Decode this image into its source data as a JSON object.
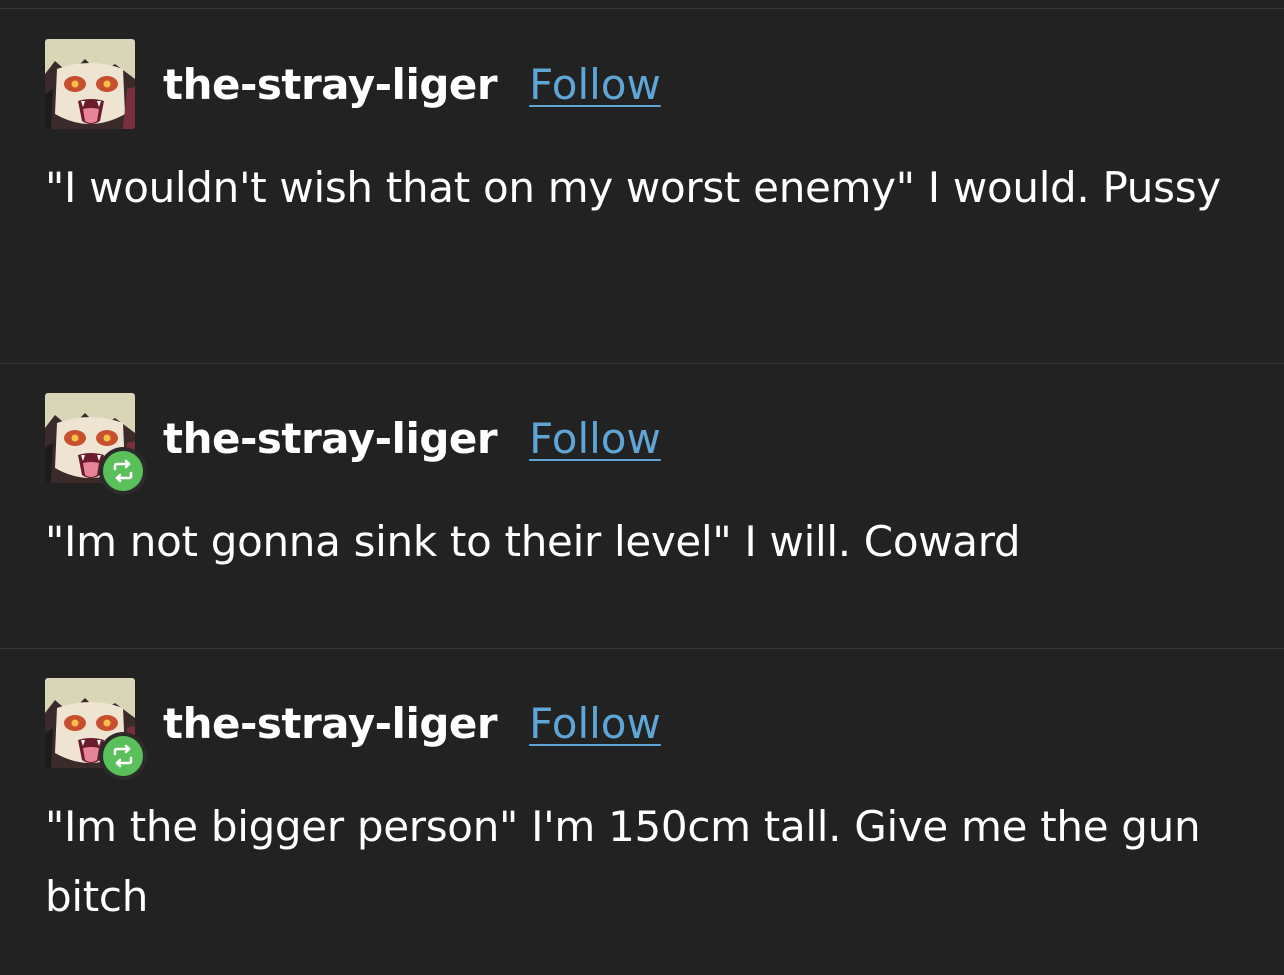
{
  "posts": [
    {
      "username": "the-stray-liger",
      "follow_label": "Follow",
      "reblog": false,
      "body": "\"I wouldn't wish that on my worst enemy\" I would. Pussy"
    },
    {
      "username": "the-stray-liger",
      "follow_label": "Follow",
      "reblog": true,
      "body": "\"Im not gonna sink to their level\" I will. Coward"
    },
    {
      "username": "the-stray-liger",
      "follow_label": "Follow",
      "reblog": true,
      "body": "\"Im the bigger person\" I'm 150cm tall. Give me the gun bitch"
    }
  ],
  "colors": {
    "background": "#222222",
    "divider": "#3a3a3a",
    "text": "#ffffff",
    "link": "#5fa6d6",
    "reblog_badge": "#5ac05a"
  },
  "icons": {
    "avatar": "anime-character-avatar",
    "reblog": "reblog-icon"
  }
}
